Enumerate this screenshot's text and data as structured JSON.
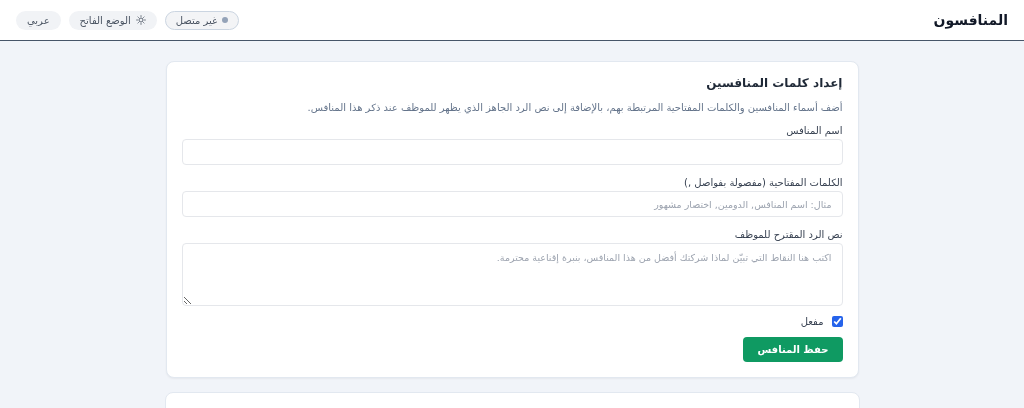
{
  "header": {
    "title": "المنافسون",
    "status": {
      "label": "غير متصل",
      "connected": false
    },
    "theme_button": {
      "label": "الوضع الفاتح"
    },
    "language_button": {
      "label": "عربي"
    }
  },
  "form": {
    "title": "إعداد كلمات المنافسين",
    "description": "أضف أسماء المنافسين والكلمات المفتاحية المرتبطة بهم، بالإضافة إلى نص الرد الجاهز الذي يظهر للموظف عند ذكر هذا المنافس.",
    "fields": [
      {
        "kind": "text",
        "label": "اسم المنافس"
      },
      {
        "kind": "text",
        "label": "الكلمات المفتاحية (مفصولة بفواصل ,)",
        "placeholder": "مثال: اسم المنافس, الدومين, اختصار مشهور"
      },
      {
        "kind": "textarea",
        "label": "نص الرد المقترح للموظف",
        "placeholder": "اكتب هنا النقاط التي تبيّن لماذا شركتك أفضل من هذا المنافس، بنبرة إقناعية محترمة."
      }
    ],
    "enabled": {
      "label": "مفعل",
      "checked": true
    },
    "save_button": "حفظ المنافس"
  }
}
